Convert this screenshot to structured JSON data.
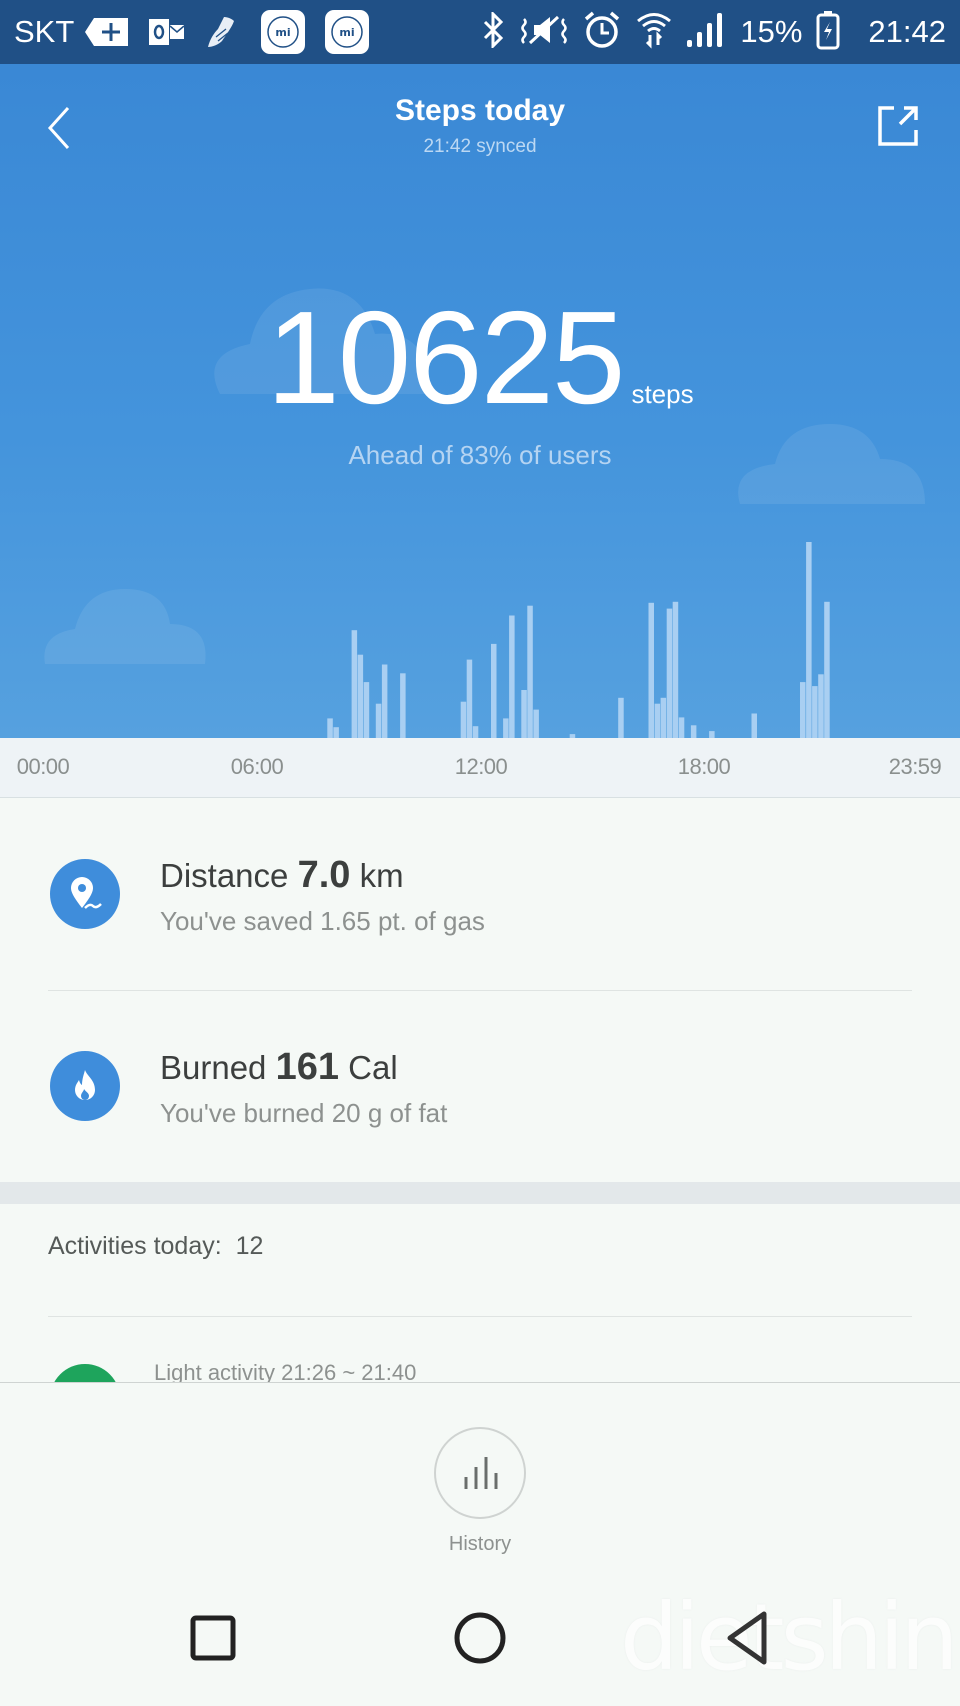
{
  "status_bar": {
    "carrier": "SKT",
    "notification_icons": [
      "add-icon",
      "outlook-icon",
      "shoe-icon",
      "mi-fit-icon",
      "mi-fit-icon"
    ],
    "system_icons": [
      "bluetooth-icon",
      "vibrate-mute-icon",
      "alarm-icon",
      "wifi-icon",
      "signal-icon"
    ],
    "battery_percent": "15%",
    "time": "21:42"
  },
  "header": {
    "title": "Steps today",
    "synced": "21:42 synced",
    "back_icon": "chevron-left-icon",
    "share_icon": "share-icon"
  },
  "summary": {
    "steps": "10625",
    "steps_unit": "steps",
    "ranking": "Ahead of 83% of users"
  },
  "colors": {
    "accent": "#3f8ddb",
    "status_bar": "#205086",
    "hero_top": "#3a88d5",
    "bar": "#a9cff2",
    "activity_green": "#1ea45c"
  },
  "chart_data": {
    "type": "bar",
    "title": "Steps today",
    "xlabel": "",
    "ylabel": "",
    "x_ticks": [
      "00:00",
      "06:00",
      "12:00",
      "18:00",
      "23:59"
    ],
    "x_range_minutes": [
      0,
      1439
    ],
    "bucket_minutes": 10,
    "grid": false,
    "ylim": [
      0,
      1000
    ],
    "bars": [
      {
        "time": "07:50",
        "value": 100
      },
      {
        "time": "08:00",
        "value": 55
      },
      {
        "time": "08:30",
        "value": 550
      },
      {
        "time": "08:40",
        "value": 425
      },
      {
        "time": "08:50",
        "value": 285
      },
      {
        "time": "09:10",
        "value": 175
      },
      {
        "time": "09:20",
        "value": 375
      },
      {
        "time": "09:50",
        "value": 330
      },
      {
        "time": "11:30",
        "value": 185
      },
      {
        "time": "11:40",
        "value": 400
      },
      {
        "time": "11:50",
        "value": 60
      },
      {
        "time": "12:20",
        "value": 480
      },
      {
        "time": "12:40",
        "value": 100
      },
      {
        "time": "12:50",
        "value": 625
      },
      {
        "time": "13:10",
        "value": 245
      },
      {
        "time": "13:20",
        "value": 675
      },
      {
        "time": "13:30",
        "value": 145
      },
      {
        "time": "14:30",
        "value": 20
      },
      {
        "time": "15:50",
        "value": 205
      },
      {
        "time": "16:40",
        "value": 690
      },
      {
        "time": "16:50",
        "value": 175
      },
      {
        "time": "17:00",
        "value": 205
      },
      {
        "time": "17:10",
        "value": 660
      },
      {
        "time": "17:20",
        "value": 695
      },
      {
        "time": "17:30",
        "value": 105
      },
      {
        "time": "17:50",
        "value": 65
      },
      {
        "time": "18:20",
        "value": 35
      },
      {
        "time": "19:30",
        "value": 125
      },
      {
        "time": "20:50",
        "value": 285
      },
      {
        "time": "21:00",
        "value": 1000
      },
      {
        "time": "21:10",
        "value": 265
      },
      {
        "time": "21:20",
        "value": 325
      },
      {
        "time": "21:30",
        "value": 695
      }
    ]
  },
  "stats": {
    "distance": {
      "icon": "location-pin-icon",
      "label": "Distance",
      "value": "7.0",
      "unit": "km",
      "note": "You've saved 1.65 pt. of gas"
    },
    "calories": {
      "icon": "flame-icon",
      "label": "Burned",
      "value": "161",
      "unit": "Cal",
      "note": "You've burned 20 g of fat"
    }
  },
  "activities": {
    "label": "Activities today:",
    "count": "12",
    "items": [
      {
        "label": "Light activity 21:26 ~ 21:40"
      }
    ]
  },
  "bottom": {
    "history_label": "History"
  },
  "watermark": "dietshin.com"
}
